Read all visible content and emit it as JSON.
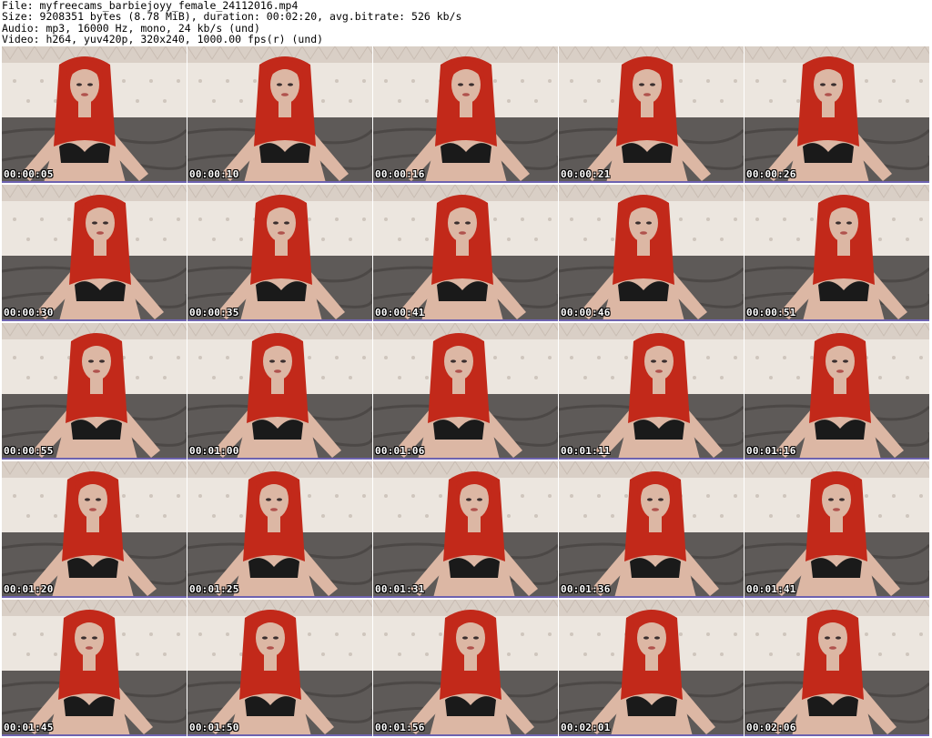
{
  "header": {
    "file": "File: myfreecams_barbiejoyy_female_24112016.mp4",
    "size": "Size: 9208351 bytes (8.78 MiB), duration: 00:02:20, avg.bitrate: 526 kb/s",
    "audio": "Audio: mp3, 16000 Hz, mono, 24 kb/s (und)",
    "video": "Video: h264, yuv420p, 320x240, 1000.00 fps(r) (und)"
  },
  "thumbnails": [
    {
      "time": "00:00:05"
    },
    {
      "time": "00:00:10"
    },
    {
      "time": "00:00:16"
    },
    {
      "time": "00:00:21"
    },
    {
      "time": "00:00:26"
    },
    {
      "time": "00:00:30"
    },
    {
      "time": "00:00:35"
    },
    {
      "time": "00:00:41"
    },
    {
      "time": "00:00:46"
    },
    {
      "time": "00:00:51"
    },
    {
      "time": "00:00:55"
    },
    {
      "time": "00:01:00"
    },
    {
      "time": "00:01:06"
    },
    {
      "time": "00:01:11"
    },
    {
      "time": "00:01:16"
    },
    {
      "time": "00:01:20"
    },
    {
      "time": "00:01:25"
    },
    {
      "time": "00:01:31"
    },
    {
      "time": "00:01:36"
    },
    {
      "time": "00:01:41"
    },
    {
      "time": "00:01:45"
    },
    {
      "time": "00:01:50"
    },
    {
      "time": "00:01:56"
    },
    {
      "time": "00:02:01"
    },
    {
      "time": "00:02:06"
    }
  ],
  "colors": {
    "wallpaper": "#d9cfc6",
    "headboard": "#ece6df",
    "bedding": "#5e5a58",
    "skin": "#dcb7a4",
    "hair": "#c2291a",
    "top": "#1a1a1a",
    "divider": "#6e63b0"
  }
}
